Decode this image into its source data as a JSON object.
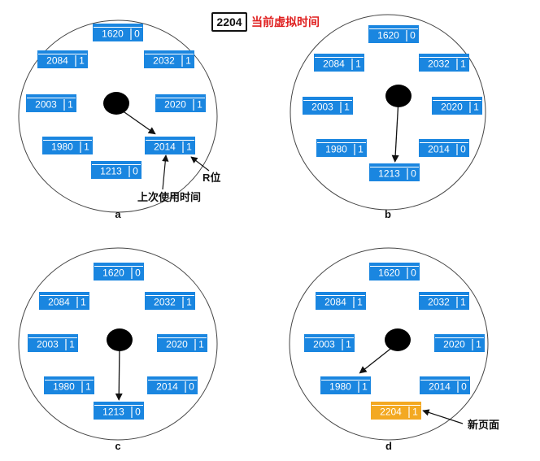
{
  "header": {
    "current_time": "2204",
    "label": "当前虚拟时间"
  },
  "colors": {
    "page_blue": "#1a86e0",
    "page_new": "#f3a922",
    "text_light": "#ffffff",
    "stroke": "#111111"
  },
  "panels": [
    {
      "id": "a",
      "caption": "a",
      "pages": [
        {
          "time": "1620",
          "r": "0"
        },
        {
          "time": "2032",
          "r": "1"
        },
        {
          "time": "2020",
          "r": "1"
        },
        {
          "time": "2014",
          "r": "1"
        },
        {
          "time": "1213",
          "r": "0"
        },
        {
          "time": "1980",
          "r": "1"
        },
        {
          "time": "2003",
          "r": "1"
        },
        {
          "time": "2084",
          "r": "1"
        }
      ],
      "pointer_target": 3,
      "annotations": [
        {
          "text": "R位",
          "target": 3,
          "part": "r"
        },
        {
          "text": "上次使用时间",
          "target": 3,
          "part": "time"
        }
      ]
    },
    {
      "id": "b",
      "caption": "b",
      "pages": [
        {
          "time": "1620",
          "r": "0"
        },
        {
          "time": "2032",
          "r": "1"
        },
        {
          "time": "2020",
          "r": "1"
        },
        {
          "time": "2014",
          "r": "0"
        },
        {
          "time": "1213",
          "r": "0"
        },
        {
          "time": "1980",
          "r": "1"
        },
        {
          "time": "2003",
          "r": "1"
        },
        {
          "time": "2084",
          "r": "1"
        }
      ],
      "pointer_target": 4,
      "annotations": []
    },
    {
      "id": "c",
      "caption": "c",
      "pages": [
        {
          "time": "1620",
          "r": "0"
        },
        {
          "time": "2032",
          "r": "1"
        },
        {
          "time": "2020",
          "r": "1"
        },
        {
          "time": "2014",
          "r": "0"
        },
        {
          "time": "1213",
          "r": "0"
        },
        {
          "time": "1980",
          "r": "1"
        },
        {
          "time": "2003",
          "r": "1"
        },
        {
          "time": "2084",
          "r": "1"
        }
      ],
      "pointer_target": 4,
      "annotations": []
    },
    {
      "id": "d",
      "caption": "d",
      "pages": [
        {
          "time": "1620",
          "r": "0"
        },
        {
          "time": "2032",
          "r": "1"
        },
        {
          "time": "2020",
          "r": "1"
        },
        {
          "time": "2014",
          "r": "0"
        },
        {
          "time": "2204",
          "r": "1",
          "new": true
        },
        {
          "time": "1980",
          "r": "1"
        },
        {
          "time": "2003",
          "r": "1"
        },
        {
          "time": "2084",
          "r": "1"
        }
      ],
      "pointer_target": 5,
      "annotations": [
        {
          "text": "新页面",
          "target": 4,
          "part": "right"
        }
      ]
    }
  ]
}
